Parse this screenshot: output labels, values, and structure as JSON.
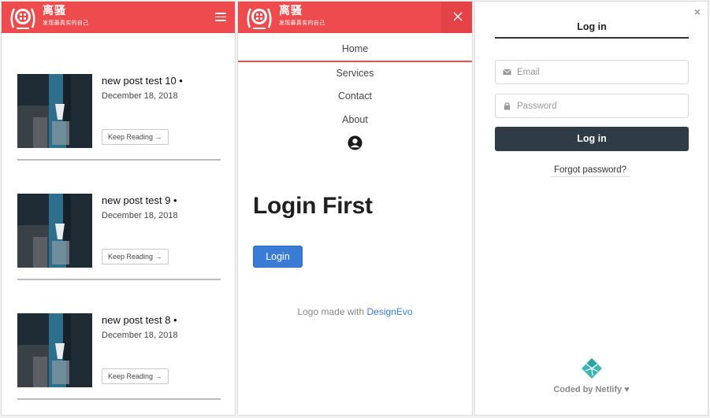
{
  "colors": {
    "brand_red": "#ee4b4e",
    "link_blue": "#3a7bd5",
    "dark_button": "#2f3c45"
  },
  "brand": {
    "name": "离骚",
    "slogan": "发现最真实的自己"
  },
  "header": {
    "menu_icon": "hamburger-icon",
    "close_icon": "close-icon"
  },
  "posts": [
    {
      "title": "new post test 10 •",
      "date": "December 18, 2018",
      "button": "Keep Reading →"
    },
    {
      "title": "new post test 9 •",
      "date": "December 18, 2018",
      "button": "Keep Reading →"
    },
    {
      "title": "new post test 8 •",
      "date": "December 18, 2018",
      "button": "Keep Reading →"
    }
  ],
  "nav": {
    "items": [
      {
        "label": "Home",
        "active": true
      },
      {
        "label": "Services"
      },
      {
        "label": "Contact"
      },
      {
        "label": "About"
      }
    ],
    "account_icon": "user-circle-icon"
  },
  "login_page": {
    "heading": "Login First",
    "button": "Login",
    "credit_prefix": "Logo made with ",
    "credit_link": "DesignEvo"
  },
  "auth_widget": {
    "close": "×",
    "title": "Log in",
    "email_placeholder": "Email",
    "password_placeholder": "Password",
    "submit": "Log in",
    "forgot": "Forgot password?",
    "footer": "Coded by Netlify ♥"
  }
}
